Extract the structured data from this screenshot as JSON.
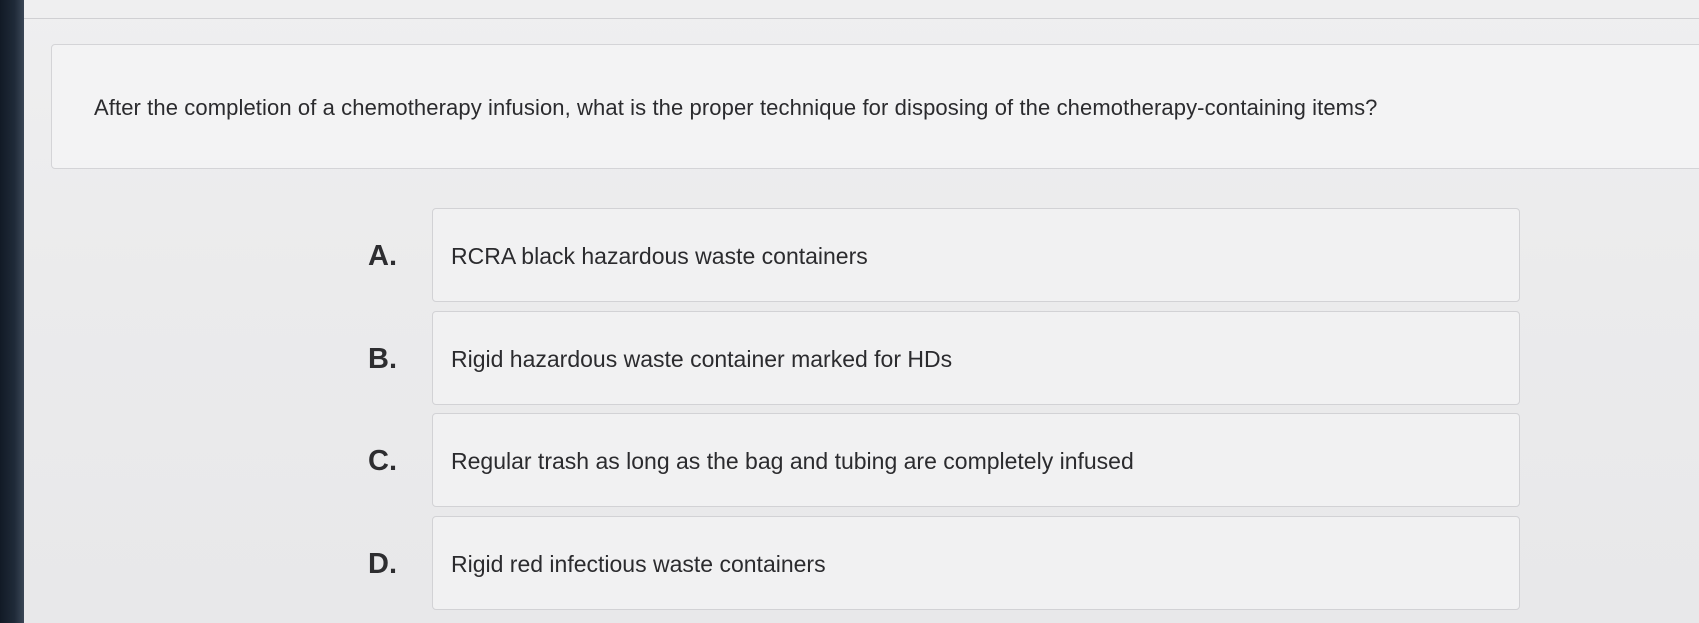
{
  "question": {
    "text": "After the completion of a chemotherapy infusion, what is the proper technique for disposing of the chemotherapy-containing items?"
  },
  "options": [
    {
      "letter": "A.",
      "text": "RCRA black hazardous waste containers"
    },
    {
      "letter": "B.",
      "text": "Rigid hazardous waste container marked for HDs"
    },
    {
      "letter": "C.",
      "text": "Regular trash as long as the bag and tubing are completely infused"
    },
    {
      "letter": "D.",
      "text": "Rigid red infectious waste containers"
    }
  ]
}
